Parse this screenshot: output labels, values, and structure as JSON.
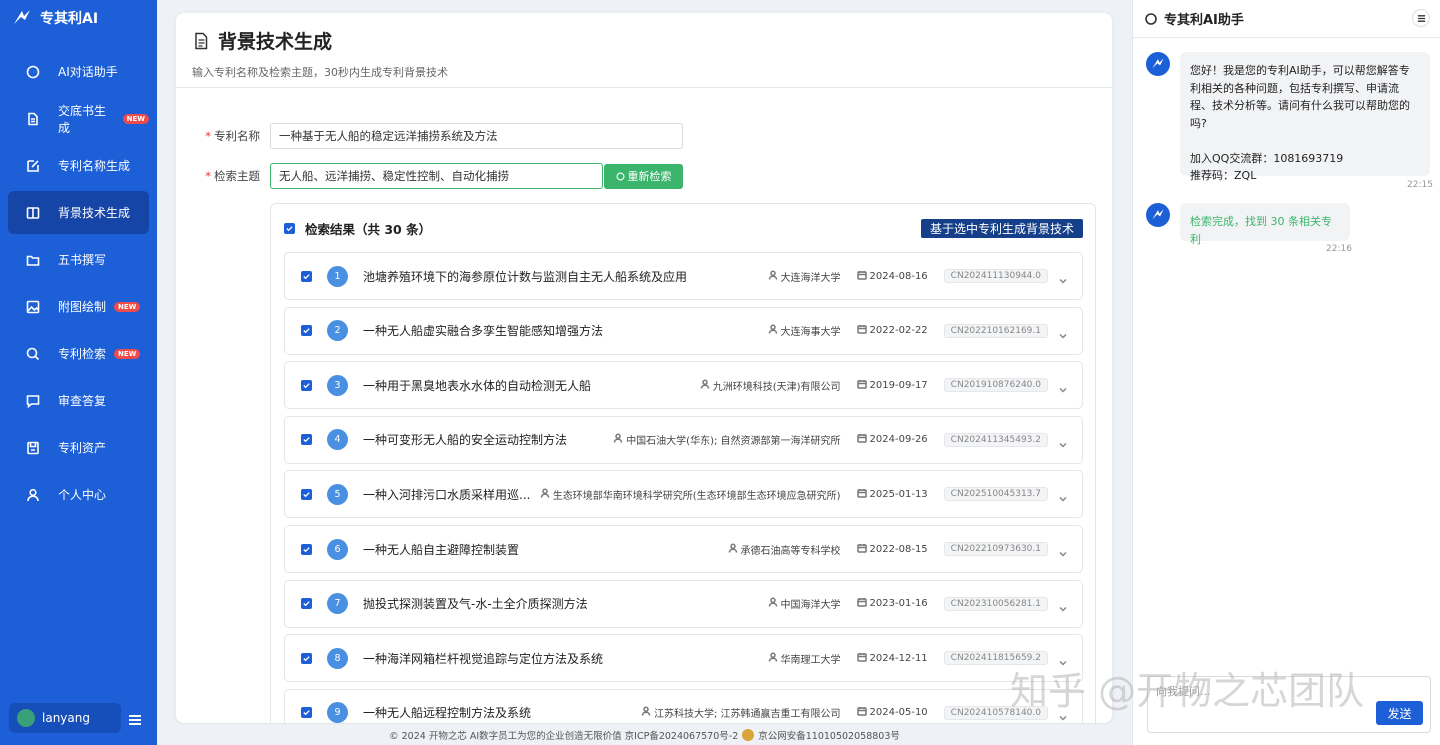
{
  "brand": {
    "name": "专其利AI"
  },
  "sidebar": {
    "items": [
      {
        "label": "AI对话助手",
        "icon": "chat-bubble-icon",
        "badge": ""
      },
      {
        "label": "交底书生成",
        "icon": "document-icon",
        "badge": "NEW"
      },
      {
        "label": "专利名称生成",
        "icon": "edit-icon",
        "badge": ""
      },
      {
        "label": "背景技术生成",
        "icon": "book-icon",
        "badge": "",
        "active": true
      },
      {
        "label": "五书撰写",
        "icon": "folder-icon",
        "badge": ""
      },
      {
        "label": "附图绘制",
        "icon": "image-icon",
        "badge": "NEW"
      },
      {
        "label": "专利检索",
        "icon": "search-icon",
        "badge": "NEW"
      },
      {
        "label": "审查答复",
        "icon": "message-square-icon",
        "badge": ""
      },
      {
        "label": "专利资产",
        "icon": "save-icon",
        "badge": ""
      },
      {
        "label": "个人中心",
        "icon": "user-icon",
        "badge": ""
      }
    ],
    "user": {
      "name": "lanyang"
    }
  },
  "page": {
    "title": "背景技术生成",
    "subtitle": "输入专利名称及检索主题，30秒内生成专利背景技术"
  },
  "form": {
    "patent_name_label": "专利名称",
    "patent_name_value": "一种基于无人船的稳定远洋捕捞系统及方法",
    "topic_label": "检索主题",
    "topic_value": "无人船、远洋捕捞、稳定性控制、自动化捕捞",
    "research_button": "重新检索"
  },
  "results": {
    "title": "检索结果（共 30 条）",
    "generate_button": "基于选中专利生成背景技术",
    "items": [
      {
        "num": "1",
        "title": "池塘养殖环境下的海参原位计数与监测自主无人船系统及应用",
        "org": "大连海洋大学",
        "date": "2024-08-16",
        "pno": "CN202411130944.0"
      },
      {
        "num": "2",
        "title": "一种无人船虚实融合多孪生智能感知增强方法",
        "org": "大连海事大学",
        "date": "2022-02-22",
        "pno": "CN202210162169.1"
      },
      {
        "num": "3",
        "title": "一种用于黑臭地表水水体的自动检测无人船",
        "org": "九洲环境科技(天津)有限公司",
        "date": "2019-09-17",
        "pno": "CN201910876240.0"
      },
      {
        "num": "4",
        "title": "一种可变形无人船的安全运动控制方法",
        "org": "中国石油大学(华东); 自然资源部第一海洋研究所",
        "date": "2024-09-26",
        "pno": "CN202411345493.2"
      },
      {
        "num": "5",
        "title": "一种入河排污口水质采样用巡...",
        "org": "生态环境部华南环境科学研究所(生态环境部生态环境应急研究所)",
        "date": "2025-01-13",
        "pno": "CN202510045313.7"
      },
      {
        "num": "6",
        "title": "一种无人船自主避障控制装置",
        "org": "承德石油高等专科学校",
        "date": "2022-08-15",
        "pno": "CN202210973630.1"
      },
      {
        "num": "7",
        "title": "抛投式探测装置及气-水-土全介质探测方法",
        "org": "中国海洋大学",
        "date": "2023-01-16",
        "pno": "CN202310056281.1"
      },
      {
        "num": "8",
        "title": "一种海洋网箱栏杆视觉追踪与定位方法及系统",
        "org": "华南理工大学",
        "date": "2024-12-11",
        "pno": "CN202411815659.2"
      },
      {
        "num": "9",
        "title": "一种无人船远程控制方法及系统",
        "org": "江苏科技大学; 江苏韩通赢吉重工有限公司",
        "date": "2024-05-10",
        "pno": "CN202410578140.0"
      }
    ]
  },
  "footer": {
    "copyright": "© 2024 开物之芯 AI数字员工为您的企业创造无限价值 京ICP备2024067570号-2",
    "police": "京公网安备11010502058803号"
  },
  "chat": {
    "title": "专其利AI助手",
    "messages": [
      {
        "text": "您好！我是您的专利AI助手，可以帮您解答专利相关的各种问题，包括专利撰写、申请流程、技术分析等。请问有什么我可以帮助您的吗?\n\n加入QQ交流群：1081693719\n推荐码：ZQL",
        "time": "22:15"
      },
      {
        "text": "检索完成，找到 30 条相关专利",
        "time": "22:16"
      }
    ],
    "input_placeholder": "向我提问...",
    "send_label": "发送"
  },
  "watermark": "知乎 @开物之芯团队",
  "colors": {
    "primary": "#1c5fd6",
    "success": "#3bb56c",
    "dark_button": "#163f8a"
  }
}
